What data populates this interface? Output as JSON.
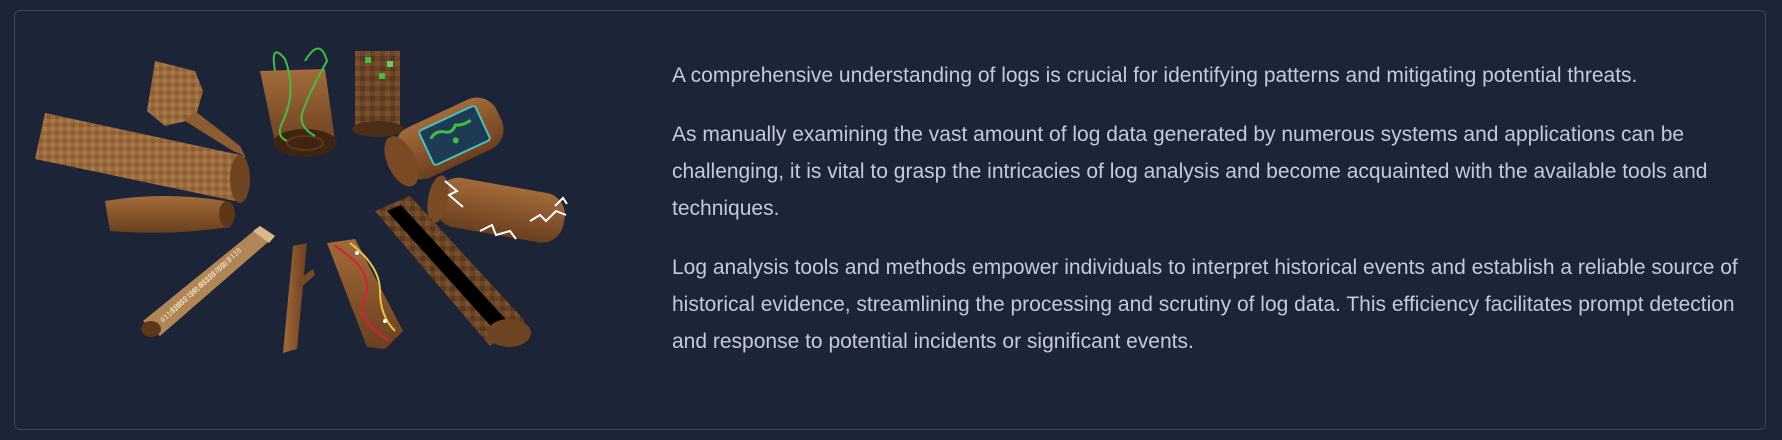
{
  "theme": {
    "background": "#1c2438",
    "border": "#3a4560",
    "text": "#c3cad8",
    "log_brown": "#8b5a30",
    "log_dark": "#5e3719",
    "log_tan": "#b08657",
    "accent_green": "#3fbf3f",
    "accent_red": "#d81e3a",
    "accent_yellow": "#e8c34a",
    "lightning": "#ffffff"
  },
  "illustration": {
    "description_icon": "log-collection-icon"
  },
  "content": {
    "paragraphs": [
      "A comprehensive understanding of logs is crucial for identifying patterns and mitigating potential threats.",
      "As manually examining the vast amount of log data generated by numerous systems and applications can be challenging, it is vital to grasp the intricacies of log analysis and become acquainted with the available tools and techniques.",
      "Log analysis tools and methods empower individuals to interpret historical events and establish a reliable source of historical evidence, streamlining the processing and scrutiny of log data. This efficiency facilitates prompt detection and response to potential incidents or significant events."
    ]
  }
}
